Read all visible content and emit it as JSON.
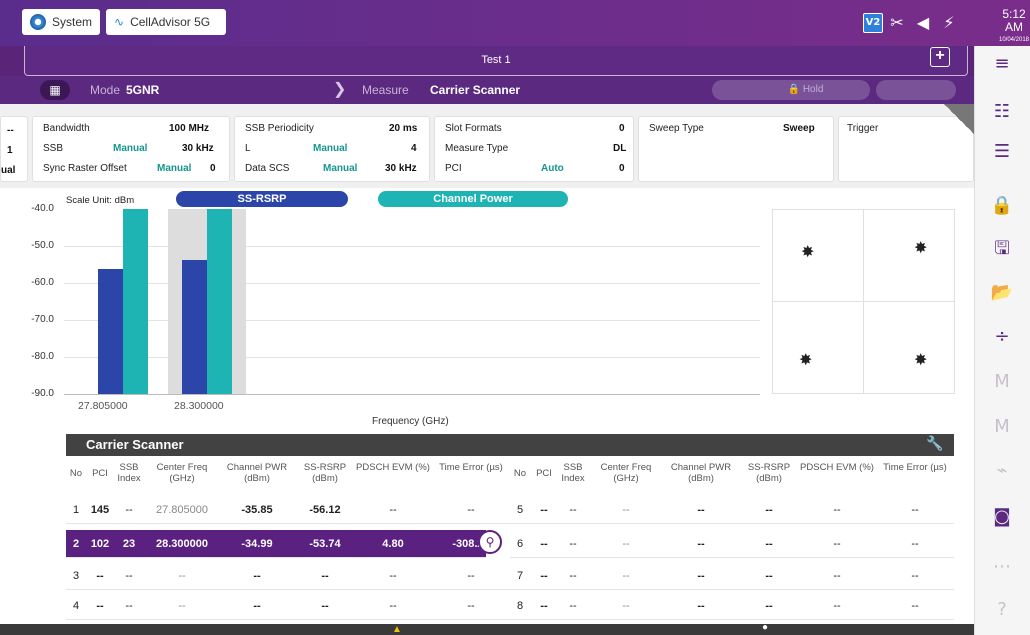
{
  "apps": {
    "system": "System",
    "cellanalyzer": "CellAdvisor 5G"
  },
  "status": {
    "badge": "V2",
    "time": "5:12 AM",
    "date": "10/04/2018"
  },
  "test": {
    "title": "Test 1"
  },
  "mode": {
    "label": "Mode",
    "value": "5GNR",
    "measure_label": "Measure",
    "measure_value": "Carrier Scanner",
    "hold": "Hold"
  },
  "params": {
    "col0": {
      "r1": "--",
      "r2": "1",
      "r3": "ual"
    },
    "col1": {
      "bandwidth_label": "Bandwidth",
      "bandwidth": "100 MHz",
      "ssb_label": "SSB",
      "ssb_mode": "Manual",
      "ssb_value": "30 kHz",
      "raster_label": "Sync Raster Offset",
      "raster_mode": "Manual",
      "raster_value": "0"
    },
    "col2": {
      "period_label": "SSB Periodicity",
      "period": "20 ms",
      "l_label": "L",
      "l_mode": "Manual",
      "l_value": "4",
      "scs_label": "Data SCS",
      "scs_mode": "Manual",
      "scs_value": "30 kHz"
    },
    "col3": {
      "slot_label": "Slot Formats",
      "slot": "0",
      "mtype_label": "Measure Type",
      "mtype": "DL",
      "pci_label": "PCI",
      "pci_mode": "Auto",
      "pci": "0"
    },
    "col4": {
      "sweep_label": "Sweep Type",
      "sweep": "Sweep"
    },
    "col5": {
      "trigger_label": "Trigger"
    }
  },
  "chart_data": {
    "type": "bar",
    "scale_unit": "Scale Unit: dBm",
    "xlabel": "Frequency (GHz)",
    "ylim": [
      -90,
      -40
    ],
    "yticks": [
      "-40.0",
      "-50.0",
      "-60.0",
      "-70.0",
      "-80.0",
      "-90.0"
    ],
    "categories": [
      "27.805000",
      "28.300000"
    ],
    "series": [
      {
        "name": "SS-RSRP",
        "values": [
          -56.12,
          -53.74
        ],
        "color": "#2b46a8"
      },
      {
        "name": "Channel Power",
        "values": [
          -35.85,
          -34.99
        ],
        "color": "#1fb4b4"
      }
    ]
  },
  "scanner": {
    "title": "Carrier Scanner",
    "headers": [
      "No",
      "PCI",
      "SSB Index",
      "Center Freq (GHz)",
      "Channel PWR (dBm)",
      "SS-RSRP (dBm)",
      "PDSCH EVM (%)",
      "Time Error (µs)"
    ],
    "left_rows": [
      [
        "1",
        "145",
        "--",
        "27.805000",
        "-35.85",
        "-56.12",
        "--",
        "--"
      ],
      [
        "2",
        "102",
        "23",
        "28.300000",
        "-34.99",
        "-53.74",
        "4.80",
        "-308.22"
      ],
      [
        "3",
        "--",
        "--",
        "--",
        "--",
        "--",
        "--",
        "--"
      ],
      [
        "4",
        "--",
        "--",
        "--",
        "--",
        "--",
        "--",
        "--"
      ]
    ],
    "right_rows": [
      [
        "5",
        "--",
        "--",
        "--",
        "--",
        "--",
        "--",
        "--"
      ],
      [
        "6",
        "--",
        "--",
        "--",
        "--",
        "--",
        "--",
        "--"
      ],
      [
        "7",
        "--",
        "--",
        "--",
        "--",
        "--",
        "--",
        "--"
      ],
      [
        "8",
        "--",
        "--",
        "--",
        "--",
        "--",
        "--",
        "--"
      ]
    ]
  },
  "icons": [
    "menu-icon",
    "settings-sliders-icon",
    "display-icon",
    "lock-icon",
    "save-icon",
    "folder-icon",
    "split-icon",
    "marker-icon",
    "marker-icon-2",
    "signal-icon",
    "screenshot-icon",
    "more-icon",
    "help-icon"
  ]
}
